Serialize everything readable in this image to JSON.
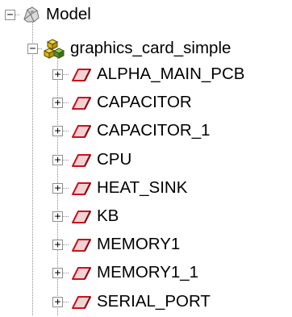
{
  "tree": {
    "root": {
      "label": "Model",
      "icon": "model-icon",
      "expander": "−"
    },
    "assembly": {
      "label": "graphics_card_simple",
      "icon": "assembly-icon",
      "expander": "−"
    },
    "parts": [
      {
        "label": "ALPHA_MAIN_PCB",
        "icon": "part-icon",
        "expander": "+"
      },
      {
        "label": "CAPACITOR",
        "icon": "part-icon",
        "expander": "+"
      },
      {
        "label": "CAPACITOR_1",
        "icon": "part-icon",
        "expander": "+"
      },
      {
        "label": "CPU",
        "icon": "part-icon",
        "expander": "+"
      },
      {
        "label": "HEAT_SINK",
        "icon": "part-icon",
        "expander": "+"
      },
      {
        "label": "KB",
        "icon": "part-icon",
        "expander": "+"
      },
      {
        "label": "MEMORY1",
        "icon": "part-icon",
        "expander": "+"
      },
      {
        "label": "MEMORY1_1",
        "icon": "part-icon",
        "expander": "+"
      },
      {
        "label": "SERIAL_PORT",
        "icon": "part-icon",
        "expander": "+"
      }
    ]
  },
  "colors": {
    "part_red": "#c8141e",
    "part_fill": "#f4d2d4",
    "assembly_yellow": "#e8c21a",
    "assembly_green": "#3c9a2a",
    "model_gray": "#7a7a7a"
  }
}
